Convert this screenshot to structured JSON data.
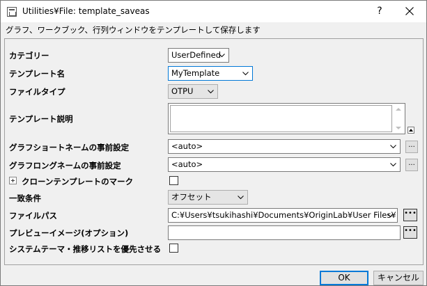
{
  "window": {
    "title": "Utilities¥File: template_saveas",
    "help_label": "?",
    "description": "グラフ、ワークブック、行列ウィンドウをテンプレートして保存します"
  },
  "form": {
    "category": {
      "label": "カテゴリー",
      "value": "UserDefined"
    },
    "template_name": {
      "label": "テンプレート名",
      "value": "MyTemplate"
    },
    "file_type": {
      "label": "ファイルタイプ",
      "value": "OTPU"
    },
    "template_description": {
      "label": "テンプレート説明",
      "value": ""
    },
    "graph_short_name": {
      "label": "グラフショートネームの事前設定",
      "value": "<auto>",
      "button": "..."
    },
    "graph_long_name": {
      "label": "グラフロングネームの事前設定",
      "value": "<auto>",
      "button": "..."
    },
    "clone_template_mark": {
      "label": "クローンテンプレートのマーク",
      "checked": false
    },
    "match_condition": {
      "label": "一致条件",
      "value": "オフセット"
    },
    "file_path": {
      "label": "ファイルパス",
      "value": "C:¥Users¥tsukihashi¥Documents¥OriginLab¥User Files¥",
      "button": "•••"
    },
    "preview_image": {
      "label": "プレビューイメージ(オプション)",
      "value": "",
      "button": "•••"
    },
    "system_theme": {
      "label": "システムテーマ・推移リストを優先させる",
      "checked": false
    }
  },
  "buttons": {
    "ok": "OK",
    "cancel": "キャンセル"
  }
}
